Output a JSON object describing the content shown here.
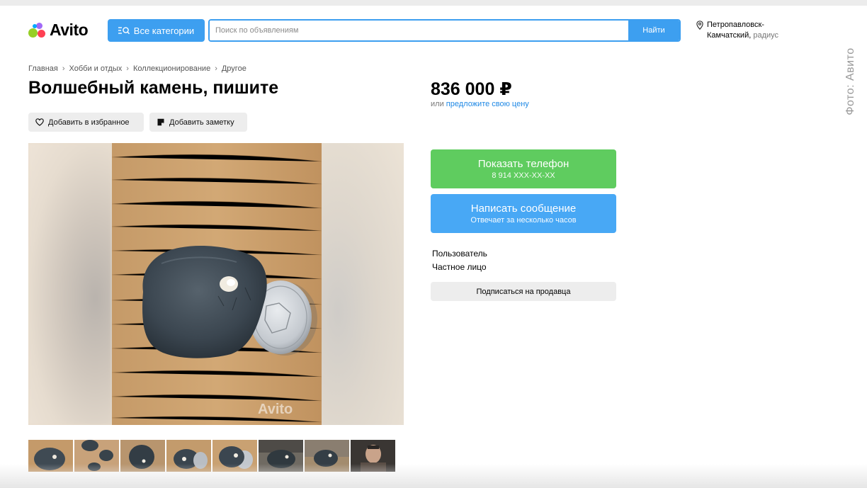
{
  "header": {
    "logo_text": "Avito",
    "categories_button": "Все категории",
    "search_placeholder": "Поиск по объявлениям",
    "search_button": "Найти",
    "location_city_line1": "Петропавловск-",
    "location_city_line2": "Камчатский,",
    "location_radius": "радиус"
  },
  "credit": "Фото: Авито",
  "breadcrumb": [
    "Главная",
    "Хобби и отдых",
    "Коллекционирование",
    "Другое"
  ],
  "listing": {
    "title": "Волшебный камень, пишите",
    "add_favorite": "Добавить в избранное",
    "add_note": "Добавить заметку",
    "price": "836 000 ₽",
    "price_offer_prefix": "или",
    "price_offer_link": "предложите свою цену",
    "photo_watermark": "Avito"
  },
  "contact": {
    "show_phone": "Показать телефон",
    "phone_masked": "8 914 XXX-XX-XX",
    "write_message": "Написать сообщение",
    "reply_time": "Отвечает за несколько часов"
  },
  "seller": {
    "role": "Пользователь",
    "type": "Частное лицо",
    "subscribe": "Подписаться на продавца"
  },
  "colors": {
    "brand_blue": "#3d9ff0",
    "phone_green": "#5fcc5f",
    "message_blue": "#48a8f5",
    "link_blue": "#1e88e5"
  },
  "thumbnails": {
    "count": 8,
    "selected_index": 4
  }
}
